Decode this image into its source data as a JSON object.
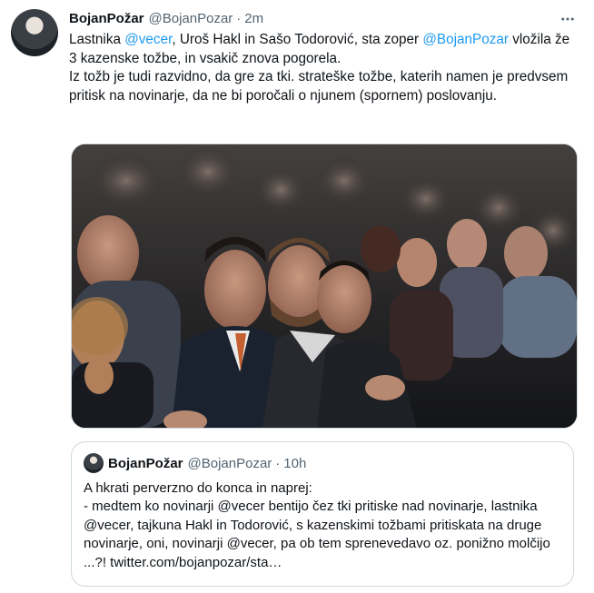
{
  "tweet": {
    "author_name": "BojanPožar",
    "handle": "@BojanPozar",
    "separator": "·",
    "time": "2m",
    "more_icon": "more-horizontal-icon",
    "text": {
      "p1_a": "Lastnika ",
      "mention1": "@vecer",
      "p1_b": ", Uroš Hakl in Sašo Todorović, sta zoper ",
      "mention2": "@BojanPozar",
      "p1_c": " vložila že 3 kazenske tožbe, in vsakič znova pogorela.",
      "p2": "Iz tožb je tudi razvidno, da gre za tki. strateške tožbe, katerih namen je predvsem pritisk na novinarje, da ne bi poročali o njunem (spornem) poslovanju."
    }
  },
  "quote": {
    "author_name": "BojanPožar",
    "handle": "@BojanPozar",
    "separator": "·",
    "time": "10h",
    "lines": [
      "A hkrati perverzno do konca in naprej:",
      "- medtem ko novinarji @vecer bentijo čez tki pritiske nad novinarje, lastnika @vecer, tajkuna Hakl in Todorović, s kazenskimi tožbami pritiskata na druge novinarje, oni, novinarji @vecer, pa ob tem sprenevedavo oz. ponižno molčijo ...?! twitter.com/bojanpozar/sta…"
    ]
  },
  "colors": {
    "link": "#1d9bf0",
    "text": "#0f1419",
    "secondary": "#536471",
    "border": "#cfd9de"
  }
}
